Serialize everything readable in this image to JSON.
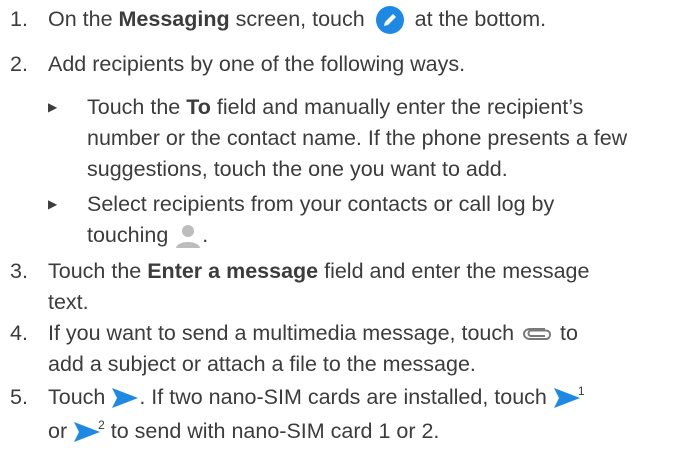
{
  "steps": [
    {
      "num": "1.",
      "a": "On the ",
      "b": "Messaging",
      "c": " screen, touch ",
      "d": " at the bottom.",
      "icon": "compose-icon"
    },
    {
      "num": "2.",
      "text": "Add recipients by one of the following ways."
    },
    {
      "num": "3.",
      "a": "Touch the ",
      "b": "Enter a message",
      "c": " field and enter the message",
      "d": "text."
    },
    {
      "num": "4.",
      "a": "If you want to send a multimedia message, touch ",
      "b": " to",
      "c": "add a subject or attach a file to the message.",
      "icon": "attach-icon"
    },
    {
      "num": "5.",
      "a": "Touch ",
      "b": ". If two nano-SIM cards are installed, touch ",
      "c": "or ",
      "d": " to send with nano-SIM card 1 or 2.",
      "icon": "send-icon",
      "sup1": "1",
      "sup2": "2"
    }
  ],
  "bullets": [
    {
      "glyph": "▶",
      "a": "Touch the ",
      "b": "To",
      "c": " field and manually enter the recipient’s",
      "d": "number or the contact name. If the phone presents a few",
      "e": "suggestions, touch the one you want to add."
    },
    {
      "glyph": "▶",
      "a": "Select recipients from your contacts or call log by",
      "b": "touching ",
      "c": ".",
      "icon": "contact-icon"
    }
  ],
  "colors": {
    "text": "#3c3c3c",
    "accent": "#1e88e5"
  }
}
